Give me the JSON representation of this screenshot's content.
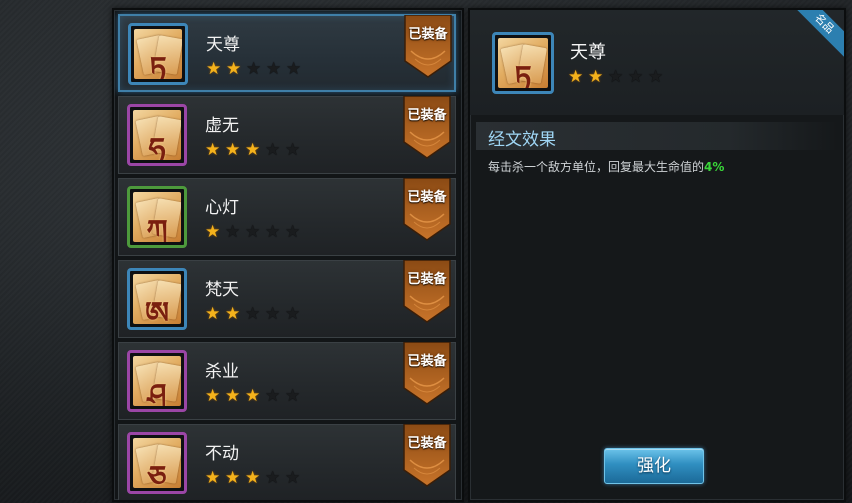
{
  "equipped_label": "已装备",
  "items": [
    {
      "name": "天尊",
      "stars": 2,
      "max_stars": 5,
      "frame": "blue",
      "glyph": "ཏ",
      "selected": true
    },
    {
      "name": "虚无",
      "stars": 3,
      "max_stars": 5,
      "frame": "purple",
      "glyph": "ཧ",
      "selected": false
    },
    {
      "name": "心灯",
      "stars": 1,
      "max_stars": 5,
      "frame": "green",
      "glyph": "ཀ",
      "selected": false
    },
    {
      "name": "梵天",
      "stars": 2,
      "max_stars": 5,
      "frame": "blue",
      "glyph": "ཨ",
      "selected": false
    },
    {
      "name": "杀业",
      "stars": 3,
      "max_stars": 5,
      "frame": "purple",
      "glyph": "ཤ",
      "selected": false
    },
    {
      "name": "不动",
      "stars": 3,
      "max_stars": 5,
      "frame": "purple",
      "glyph": "ཅ",
      "selected": false
    }
  ],
  "detail": {
    "name": "天尊",
    "stars": 2,
    "max_stars": 5,
    "corner_tag": "名品",
    "section_title": "经文效果",
    "effect_prefix": "每击杀一个敌方单位，回复最大生命值的",
    "effect_value": "4%",
    "enhance_label": "强化"
  },
  "colors": {
    "star_on": "#f4b21c",
    "highlight_green": "#39d639",
    "accent_blue": "#3d86b8",
    "badge_orange": "#b8621c"
  }
}
